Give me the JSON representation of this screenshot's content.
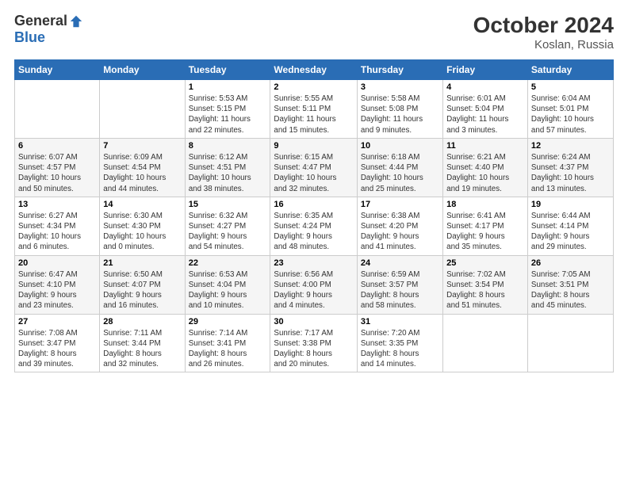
{
  "logo": {
    "general": "General",
    "blue": "Blue"
  },
  "title": "October 2024",
  "location": "Koslan, Russia",
  "days_header": [
    "Sunday",
    "Monday",
    "Tuesday",
    "Wednesday",
    "Thursday",
    "Friday",
    "Saturday"
  ],
  "weeks": [
    [
      {
        "num": "",
        "info": ""
      },
      {
        "num": "",
        "info": ""
      },
      {
        "num": "1",
        "info": "Sunrise: 5:53 AM\nSunset: 5:15 PM\nDaylight: 11 hours\nand 22 minutes."
      },
      {
        "num": "2",
        "info": "Sunrise: 5:55 AM\nSunset: 5:11 PM\nDaylight: 11 hours\nand 15 minutes."
      },
      {
        "num": "3",
        "info": "Sunrise: 5:58 AM\nSunset: 5:08 PM\nDaylight: 11 hours\nand 9 minutes."
      },
      {
        "num": "4",
        "info": "Sunrise: 6:01 AM\nSunset: 5:04 PM\nDaylight: 11 hours\nand 3 minutes."
      },
      {
        "num": "5",
        "info": "Sunrise: 6:04 AM\nSunset: 5:01 PM\nDaylight: 10 hours\nand 57 minutes."
      }
    ],
    [
      {
        "num": "6",
        "info": "Sunrise: 6:07 AM\nSunset: 4:57 PM\nDaylight: 10 hours\nand 50 minutes."
      },
      {
        "num": "7",
        "info": "Sunrise: 6:09 AM\nSunset: 4:54 PM\nDaylight: 10 hours\nand 44 minutes."
      },
      {
        "num": "8",
        "info": "Sunrise: 6:12 AM\nSunset: 4:51 PM\nDaylight: 10 hours\nand 38 minutes."
      },
      {
        "num": "9",
        "info": "Sunrise: 6:15 AM\nSunset: 4:47 PM\nDaylight: 10 hours\nand 32 minutes."
      },
      {
        "num": "10",
        "info": "Sunrise: 6:18 AM\nSunset: 4:44 PM\nDaylight: 10 hours\nand 25 minutes."
      },
      {
        "num": "11",
        "info": "Sunrise: 6:21 AM\nSunset: 4:40 PM\nDaylight: 10 hours\nand 19 minutes."
      },
      {
        "num": "12",
        "info": "Sunrise: 6:24 AM\nSunset: 4:37 PM\nDaylight: 10 hours\nand 13 minutes."
      }
    ],
    [
      {
        "num": "13",
        "info": "Sunrise: 6:27 AM\nSunset: 4:34 PM\nDaylight: 10 hours\nand 6 minutes."
      },
      {
        "num": "14",
        "info": "Sunrise: 6:30 AM\nSunset: 4:30 PM\nDaylight: 10 hours\nand 0 minutes."
      },
      {
        "num": "15",
        "info": "Sunrise: 6:32 AM\nSunset: 4:27 PM\nDaylight: 9 hours\nand 54 minutes."
      },
      {
        "num": "16",
        "info": "Sunrise: 6:35 AM\nSunset: 4:24 PM\nDaylight: 9 hours\nand 48 minutes."
      },
      {
        "num": "17",
        "info": "Sunrise: 6:38 AM\nSunset: 4:20 PM\nDaylight: 9 hours\nand 41 minutes."
      },
      {
        "num": "18",
        "info": "Sunrise: 6:41 AM\nSunset: 4:17 PM\nDaylight: 9 hours\nand 35 minutes."
      },
      {
        "num": "19",
        "info": "Sunrise: 6:44 AM\nSunset: 4:14 PM\nDaylight: 9 hours\nand 29 minutes."
      }
    ],
    [
      {
        "num": "20",
        "info": "Sunrise: 6:47 AM\nSunset: 4:10 PM\nDaylight: 9 hours\nand 23 minutes."
      },
      {
        "num": "21",
        "info": "Sunrise: 6:50 AM\nSunset: 4:07 PM\nDaylight: 9 hours\nand 16 minutes."
      },
      {
        "num": "22",
        "info": "Sunrise: 6:53 AM\nSunset: 4:04 PM\nDaylight: 9 hours\nand 10 minutes."
      },
      {
        "num": "23",
        "info": "Sunrise: 6:56 AM\nSunset: 4:00 PM\nDaylight: 9 hours\nand 4 minutes."
      },
      {
        "num": "24",
        "info": "Sunrise: 6:59 AM\nSunset: 3:57 PM\nDaylight: 8 hours\nand 58 minutes."
      },
      {
        "num": "25",
        "info": "Sunrise: 7:02 AM\nSunset: 3:54 PM\nDaylight: 8 hours\nand 51 minutes."
      },
      {
        "num": "26",
        "info": "Sunrise: 7:05 AM\nSunset: 3:51 PM\nDaylight: 8 hours\nand 45 minutes."
      }
    ],
    [
      {
        "num": "27",
        "info": "Sunrise: 7:08 AM\nSunset: 3:47 PM\nDaylight: 8 hours\nand 39 minutes."
      },
      {
        "num": "28",
        "info": "Sunrise: 7:11 AM\nSunset: 3:44 PM\nDaylight: 8 hours\nand 32 minutes."
      },
      {
        "num": "29",
        "info": "Sunrise: 7:14 AM\nSunset: 3:41 PM\nDaylight: 8 hours\nand 26 minutes."
      },
      {
        "num": "30",
        "info": "Sunrise: 7:17 AM\nSunset: 3:38 PM\nDaylight: 8 hours\nand 20 minutes."
      },
      {
        "num": "31",
        "info": "Sunrise: 7:20 AM\nSunset: 3:35 PM\nDaylight: 8 hours\nand 14 minutes."
      },
      {
        "num": "",
        "info": ""
      },
      {
        "num": "",
        "info": ""
      }
    ]
  ]
}
